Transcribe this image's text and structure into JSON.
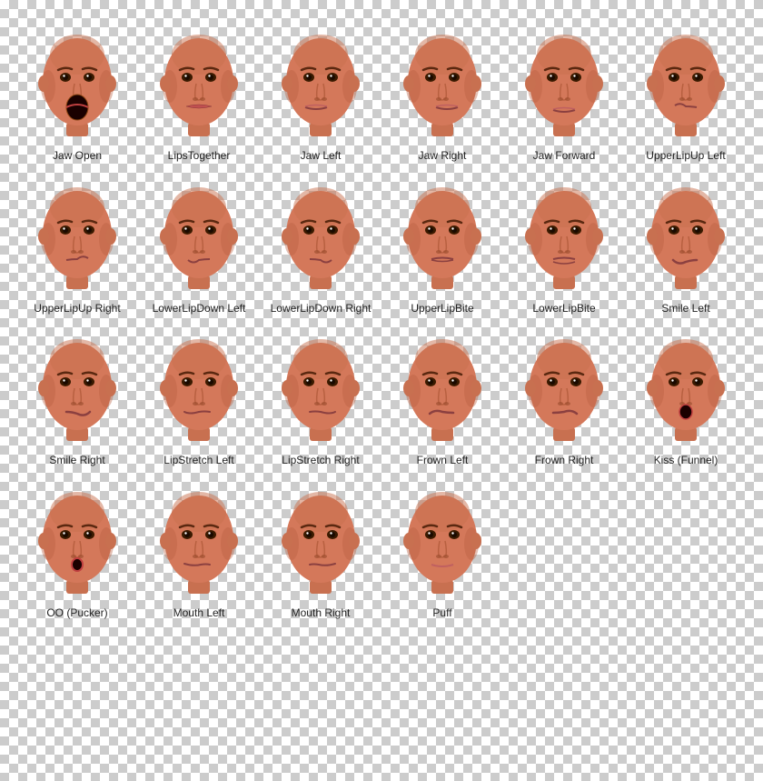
{
  "faces": [
    {
      "id": "jaw-open",
      "label": "Jaw Open",
      "mouth": "open"
    },
    {
      "id": "lips-together",
      "label": "LipsTogether",
      "mouth": "together"
    },
    {
      "id": "jaw-left",
      "label": "Jaw Left",
      "mouth": "normal"
    },
    {
      "id": "jaw-right",
      "label": "Jaw Right",
      "mouth": "normal"
    },
    {
      "id": "jaw-forward",
      "label": "Jaw Forward",
      "mouth": "normal"
    },
    {
      "id": "upper-lip-up-left",
      "label": "UpperLipUp\nLeft",
      "mouth": "upper-left"
    },
    {
      "id": "upper-lip-up-right",
      "label": "UpperLipUp\nRight",
      "mouth": "upper-right"
    },
    {
      "id": "lower-lip-down-left",
      "label": "LowerLipDown\nLeft",
      "mouth": "lower-left"
    },
    {
      "id": "lower-lip-down-right",
      "label": "LowerLipDown\nRight",
      "mouth": "lower-right"
    },
    {
      "id": "upper-lip-bite",
      "label": "UpperLipBite",
      "mouth": "bite"
    },
    {
      "id": "lower-lip-bite",
      "label": "LowerLipBite",
      "mouth": "lower-bite"
    },
    {
      "id": "smile-left",
      "label": "Smile Left",
      "mouth": "smile-left"
    },
    {
      "id": "smile-right",
      "label": "Smile Right",
      "mouth": "smile-right"
    },
    {
      "id": "lip-stretch-left",
      "label": "LipStretch\nLeft",
      "mouth": "stretch-left"
    },
    {
      "id": "lip-stretch-right",
      "label": "LipStretch\nRight",
      "mouth": "stretch-right"
    },
    {
      "id": "frown-left",
      "label": "Frown Left",
      "mouth": "frown-left"
    },
    {
      "id": "frown-right",
      "label": "Frown Right",
      "mouth": "frown-right"
    },
    {
      "id": "kiss-funnel",
      "label": "Kiss (Funnel)",
      "mouth": "funnel"
    },
    {
      "id": "oo-pucker",
      "label": "OO (Pucker)",
      "mouth": "pucker"
    },
    {
      "id": "mouth-left",
      "label": "Mouth Left",
      "mouth": "mouth-left"
    },
    {
      "id": "mouth-right",
      "label": "Mouth Right",
      "mouth": "mouth-right"
    },
    {
      "id": "puff",
      "label": "Puff",
      "mouth": "puff"
    }
  ]
}
